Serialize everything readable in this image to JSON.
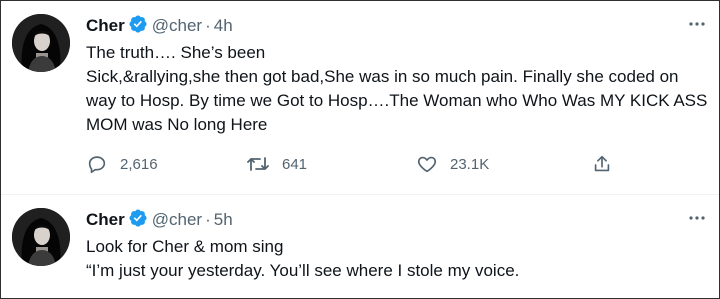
{
  "tweets": [
    {
      "display_name": "Cher",
      "handle": "@cher",
      "separator": "·",
      "time": "4h",
      "text_lines": [
        "The truth…. She’s been",
        "Sick,&rallying,she then got bad,She was in so much pain. Finally she coded on way to Hosp. By time we Got to Hosp….The Woman who Who Was MY KICK ASS MOM was No long Here"
      ],
      "replies": "2,616",
      "retweets": "641",
      "likes": "23.1K"
    },
    {
      "display_name": "Cher",
      "handle": "@cher",
      "separator": "·",
      "time": "5h",
      "text_lines": [
        "Look for Cher & mom sing",
        "“I’m just your yesterday. You’ll see where I stole my voice."
      ]
    }
  ],
  "colors": {
    "verified": "#1d9bf0",
    "secondary_text": "#536471",
    "primary_text": "#0f1419"
  },
  "icons": [
    "verified-badge-icon",
    "more-icon",
    "reply-icon",
    "retweet-icon",
    "like-icon",
    "share-icon"
  ]
}
